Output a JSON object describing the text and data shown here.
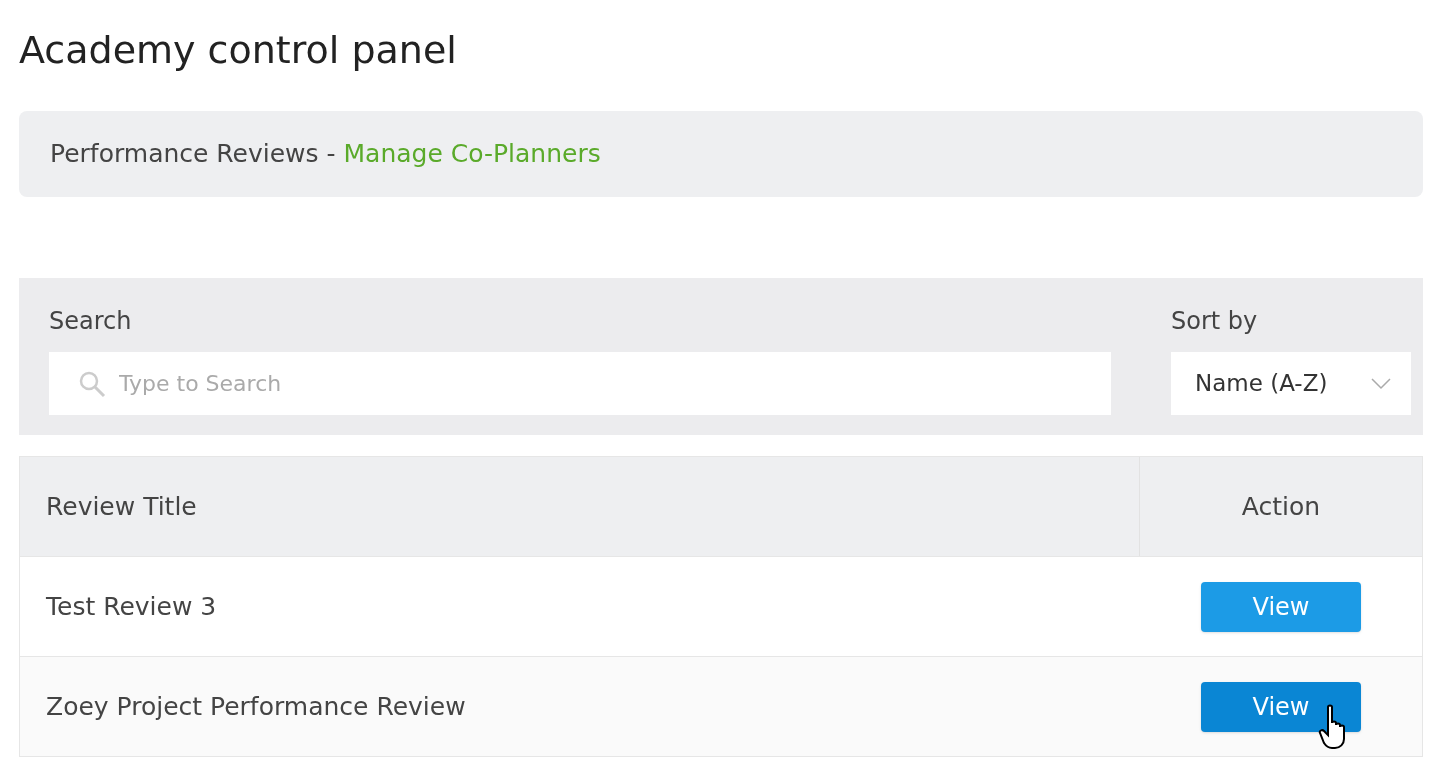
{
  "page_title": "Academy control panel",
  "breadcrumb": {
    "section": "Performance Reviews - ",
    "link": "Manage Co-Planners"
  },
  "search": {
    "label": "Search",
    "placeholder": "Type to Search"
  },
  "sort": {
    "label": "Sort by",
    "value": "Name (A-Z)"
  },
  "table": {
    "columns": [
      "Review Title",
      "Action"
    ],
    "rows": [
      {
        "title": "Test Review 3",
        "action": "View",
        "hovered": false
      },
      {
        "title": "Zoey Project Performance Review",
        "action": "View",
        "hovered": true
      }
    ]
  }
}
